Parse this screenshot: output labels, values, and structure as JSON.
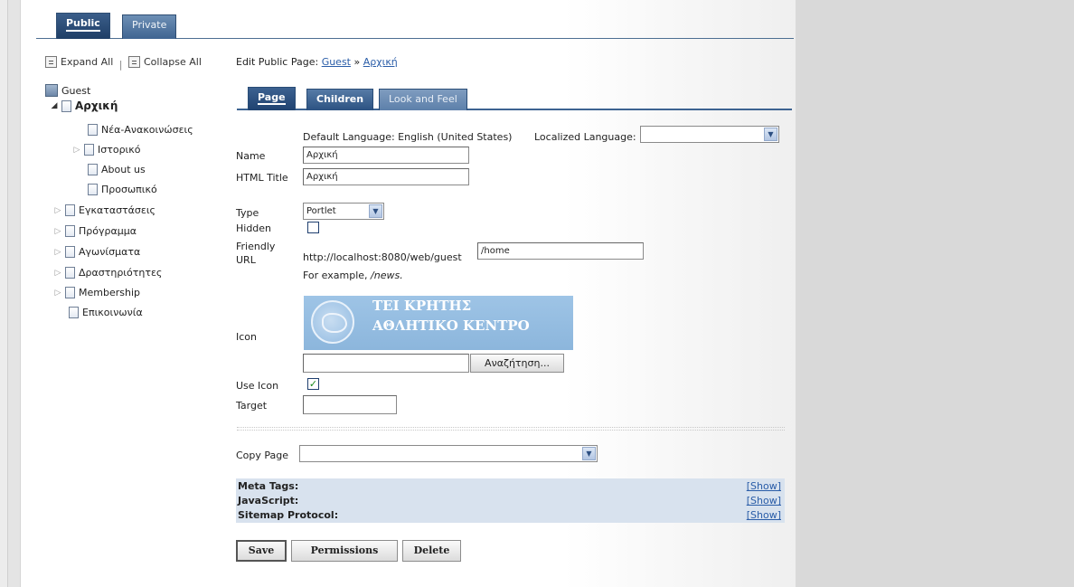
{
  "top_tabs": {
    "public": "Public",
    "private": "Private"
  },
  "tree": {
    "expand_all": "Expand All",
    "separator": "|",
    "collapse_all": "Collapse All",
    "root": "Guest",
    "items": [
      {
        "label": "Αρχική",
        "bold": true,
        "expanded": true
      },
      {
        "label": "Νέα-Ανακοινώσεις"
      },
      {
        "label": "Ιστορικό"
      },
      {
        "label": "About us"
      },
      {
        "label": "Προσωπικό"
      },
      {
        "label": "Εγκαταστάσεις"
      },
      {
        "label": "Πρόγραμμα"
      },
      {
        "label": "Αγωνίσματα"
      },
      {
        "label": "Δραστηριότητες"
      },
      {
        "label": "Membership"
      },
      {
        "label": "Επικοινωνία"
      }
    ]
  },
  "breadcrumb": {
    "prefix": "Edit Public Page:",
    "guest": "Guest",
    "arrow": "»",
    "current": "Αρχική"
  },
  "page_tabs": {
    "page": "Page",
    "children": "Children",
    "look_and_feel": "Look and Feel"
  },
  "form": {
    "default_language": "Default Language: English (United States)",
    "localized_language_label": "Localized Language:",
    "localized_language_value": "",
    "name_label": "Name",
    "name_value": "Αρχική",
    "html_title_label": "HTML Title",
    "html_title_value": "Αρχική",
    "type_label": "Type",
    "type_value": "Portlet",
    "hidden_label": "Hidden",
    "hidden_checked": false,
    "friendly_url_label_1": "Friendly",
    "friendly_url_label_2": "URL",
    "friendly_url_prefix": "http://localhost:8080/web/guest",
    "friendly_url_value": "/home",
    "example_text": "For example,",
    "example_value": "/news.",
    "icon_label": "Icon",
    "icon_line1": "ΤΕΙ ΚΡΗΤΗΣ",
    "icon_line2": "ΑΘΛΗΤΙΚΟ ΚΕΝΤΡΟ",
    "icon_file_value": "",
    "browse_button": "Αναζήτηση...",
    "use_icon_label": "Use Icon",
    "use_icon_checked": true,
    "target_label": "Target",
    "target_value": "",
    "copy_page_label": "Copy Page",
    "copy_page_value": ""
  },
  "meta": [
    {
      "label": "Meta Tags:",
      "link": "[Show]"
    },
    {
      "label": "JavaScript:",
      "link": "[Show]"
    },
    {
      "label": "Sitemap Protocol:",
      "link": "[Show]"
    }
  ],
  "buttons": {
    "save": "Save",
    "permissions": "Permissions",
    "delete": "Delete"
  },
  "colors": {
    "tab_dark": "#1f4270",
    "meta_bg": "#d8e2ee",
    "link": "#2a5da8"
  },
  "icons": {
    "expand_all": "expand-all-icon",
    "collapse_all": "collapse-all-icon",
    "page": "page-icon",
    "house": "house-icon",
    "dropdown": "dropdown-arrow-icon"
  }
}
